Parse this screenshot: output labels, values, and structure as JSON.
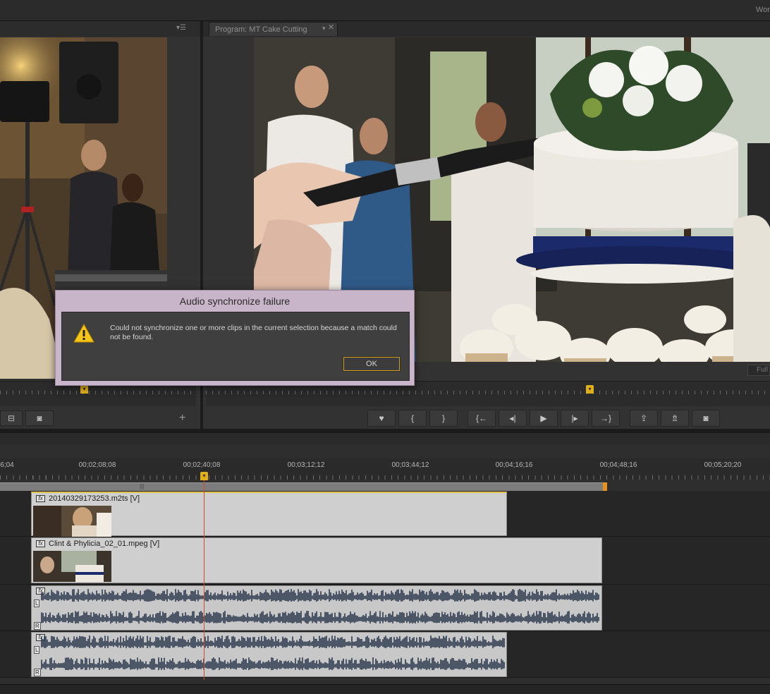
{
  "app": {
    "workspace_label": "Wor"
  },
  "source_monitor": {
    "menu_icon": "panel-menu-icon",
    "buttons": [
      {
        "name": "export-frame-button",
        "icon": "camera-icon"
      },
      {
        "name": "add-button",
        "icon": "plus-icon"
      }
    ]
  },
  "program_monitor": {
    "tab_label": "Program: MT Cake Cutting",
    "fit_label": "Full",
    "transport": [
      {
        "name": "add-marker-button",
        "glyph": "♥",
        "icon": "marker-icon"
      },
      {
        "name": "mark-in-button",
        "glyph": "{",
        "icon": "mark-in-icon"
      },
      {
        "name": "mark-out-button",
        "glyph": "}",
        "icon": "mark-out-icon"
      },
      {
        "name": "go-to-in-button",
        "glyph": "{←",
        "icon": "go-to-in-icon"
      },
      {
        "name": "step-back-button",
        "glyph": "◂|",
        "icon": "step-back-icon"
      },
      {
        "name": "play-button",
        "glyph": "▶",
        "icon": "play-icon"
      },
      {
        "name": "step-forward-button",
        "glyph": "|▸",
        "icon": "step-forward-icon"
      },
      {
        "name": "go-to-out-button",
        "glyph": "→}",
        "icon": "go-to-out-icon"
      },
      {
        "name": "lift-button",
        "glyph": "⇪",
        "icon": "lift-icon"
      },
      {
        "name": "extract-button",
        "glyph": "⇯",
        "icon": "extract-icon"
      },
      {
        "name": "export-frame-button",
        "glyph": "◙",
        "icon": "camera-icon"
      }
    ]
  },
  "timeline": {
    "timecodes": [
      "6;04",
      "00;02;08;08",
      "00;02;40;08",
      "00;03;12;12",
      "00;03;44;12",
      "00;04;16;16",
      "00;04;48;16",
      "00;05;20;20"
    ],
    "clips": {
      "v2_name": "20140329173253.m2ts [V]",
      "v1_name": "Clint & Phylicia_02_01.mpeg [V]",
      "audio_channel_left": "L",
      "audio_channel_right": "R"
    }
  },
  "dialog": {
    "title": "Audio synchronize failure",
    "message": "Could not synchronize one or more clips in the current selection because a match could not be found.",
    "ok_label": "OK",
    "icon": "warning-icon",
    "colors": {
      "titlebar": "#c9b5c9",
      "warning": "#f5c518",
      "ok_border": "#d9a21d"
    }
  }
}
